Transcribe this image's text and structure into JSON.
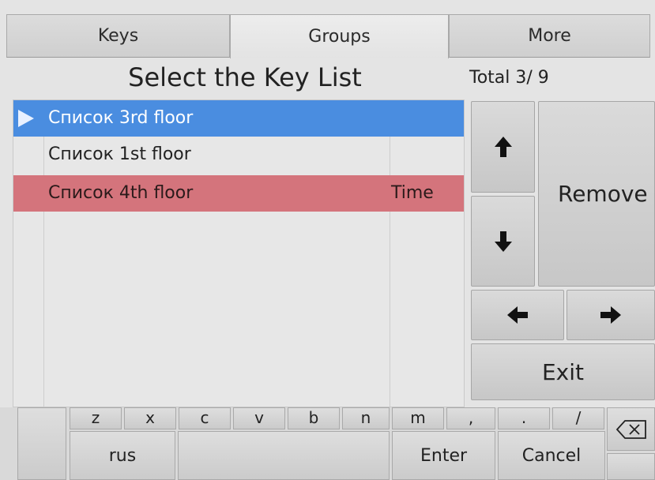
{
  "tabs": [
    {
      "label": "Keys"
    },
    {
      "label": "Groups"
    },
    {
      "label": "More"
    }
  ],
  "header": {
    "title": "Select the Key List",
    "total": "Total 3/ 9"
  },
  "list": {
    "rows": [
      {
        "name": "Список 3rd floor",
        "extra": "",
        "state": "selected"
      },
      {
        "name": "Список 1st floor",
        "extra": "",
        "state": "normal"
      },
      {
        "name": "Список 4th floor",
        "extra": "Time",
        "state": "alert"
      }
    ]
  },
  "buttons": {
    "up_icon": "arrow-up-icon",
    "down_icon": "arrow-down-icon",
    "left_icon": "arrow-left-icon",
    "right_icon": "arrow-right-icon",
    "remove": "Remove",
    "exit": "Exit"
  },
  "keyboard": {
    "top_keys": [
      "z",
      "x",
      "c",
      "v",
      "b",
      "n",
      "m",
      ",",
      ".",
      "/"
    ],
    "backspace_icon": "backspace-icon",
    "lang": "rus",
    "enter": "Enter",
    "cancel": "Cancel"
  },
  "colors": {
    "selected_row": "#4a8de0",
    "alert_row": "#d4747c",
    "background": "#e4e4e4"
  }
}
